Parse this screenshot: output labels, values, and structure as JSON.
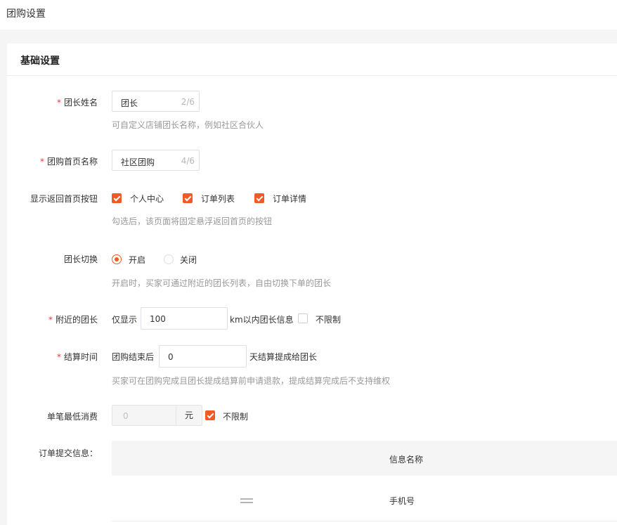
{
  "page": {
    "title": "团购设置"
  },
  "section": {
    "title": "基础设置"
  },
  "leader_name": {
    "label": "团长姓名",
    "value": "团长",
    "count": "2/6",
    "help": "可自定义店铺团长名称，例如社区合伙人"
  },
  "home_name": {
    "label": "团购首页名称",
    "value": "社区团购",
    "count": "4/6"
  },
  "back_home": {
    "label": "显示返回首页按钮",
    "options": [
      {
        "label": "个人中心",
        "checked": true
      },
      {
        "label": "订单列表",
        "checked": true
      },
      {
        "label": "订单详情",
        "checked": true
      }
    ],
    "help": "勾选后，该页面将固定悬浮返回首页的按钮"
  },
  "leader_switch": {
    "label": "团长切换",
    "on_label": "开启",
    "off_label": "关闭",
    "selected": "on",
    "help": "开启时，买家可通过附近的团长列表，自由切换下单的团长"
  },
  "nearby": {
    "label": "附近的团长",
    "prefix": "仅显示",
    "value": "100",
    "suffix": "km以内团长信息",
    "unlimited_label": "不限制",
    "unlimited_checked": false
  },
  "settlement": {
    "label": "结算时间",
    "prefix": "团购结束后",
    "value": "0",
    "suffix": "天结算提成给团长",
    "help": "买家可在团购完成且团长提成结算前申请退款，提成结算完成后不支持维权"
  },
  "min_spend": {
    "label": "单笔最低消费",
    "placeholder": "0",
    "unit": "元",
    "unlimited_label": "不限制",
    "unlimited_checked": true
  },
  "order_info": {
    "label": "订单提交信息：",
    "column_header": "信息名称",
    "rows": [
      {
        "name": "手机号"
      }
    ]
  },
  "colors": {
    "accent": "#f15a24",
    "required": "#e4393c"
  }
}
